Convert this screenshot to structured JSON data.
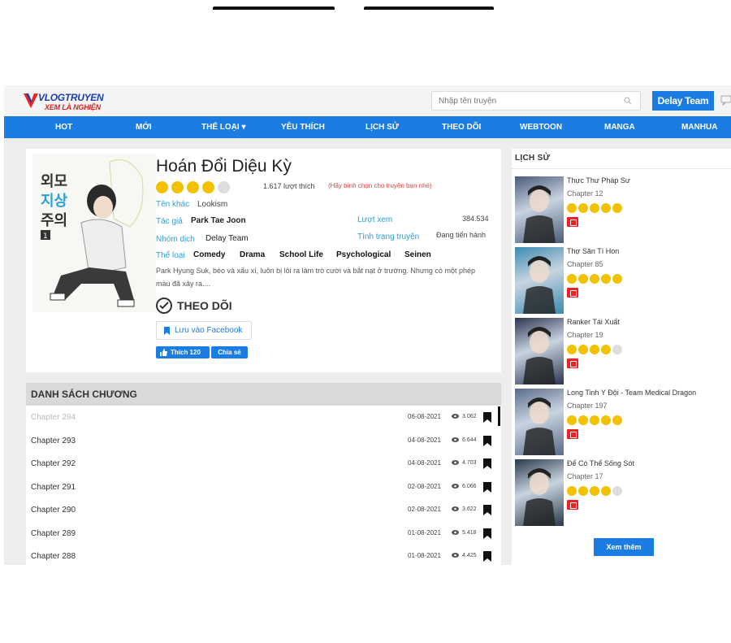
{
  "header": {
    "logo_line1": "VLOGTRUYEN",
    "logo_line2": "XEM LÀ NGHIỆN",
    "search_placeholder": "Nhập tên truyện",
    "team_button": "Delay Team"
  },
  "nav": [
    "HOT",
    "MỚI",
    "THỂ LOẠI ▾",
    "YÊU THÍCH",
    "LỊCH SỬ",
    "THEO DÕI",
    "WEBTOON",
    "MANGA",
    "MANHUA"
  ],
  "manga": {
    "title": "Hoán Đổi Diệu Kỳ",
    "rating": 4,
    "likes": "1.617 lượt thích",
    "vote_prompt": "(Hãy bình chọn cho truyện bạn nhé)",
    "other_name_label": "Tên khác",
    "other_name": "Lookism",
    "author_label": "Tác giả",
    "author": "Park Tae Joon",
    "views_label": "Lượt xem",
    "views": "384.534",
    "translator_label": "Nhóm dịch",
    "translator": "Delay Team",
    "status_label": "Tình trạng truyện",
    "status": "Đang tiến hành",
    "genre_label": "Thể loại",
    "genres": [
      "Comedy",
      "Drama",
      "School Life",
      "Psychological",
      "Seinen"
    ],
    "description": "Park Hyung Suk, béo và xấu xí, luôn bị lôi ra làm trò cười và bắt nạt ở trường. Nhưng có một phép màu đã xảy ra....",
    "follow_label": "THEO DÕI",
    "save_fb_label": "Lưu vào Facebook",
    "fb_like_label": "Thích 120",
    "fb_share_label": "Chia sẻ",
    "cover_text": [
      "외모",
      "지상",
      "주의"
    ],
    "cover_volume": "1"
  },
  "chapters": {
    "heading": "DANH SÁCH CHƯƠNG",
    "rows": [
      {
        "name": "Chapter 294",
        "date": "06-08-2021",
        "views": "3.062",
        "faded": true
      },
      {
        "name": "Chapter 293",
        "date": "04-08-2021",
        "views": "6.644"
      },
      {
        "name": "Chapter 292",
        "date": "04-08-2021",
        "views": "4.703"
      },
      {
        "name": "Chapter 291",
        "date": "02-08-2021",
        "views": "6.066"
      },
      {
        "name": "Chapter 290",
        "date": "02-08-2021",
        "views": "3.622"
      },
      {
        "name": "Chapter 289",
        "date": "01-08-2021",
        "views": "5.418"
      },
      {
        "name": "Chapter 288",
        "date": "01-08-2021",
        "views": "4.425"
      }
    ]
  },
  "history": {
    "heading": "LỊCH SỬ",
    "items": [
      {
        "name": "Thực Thư Pháp Sư",
        "chapter": "Chapter 12",
        "rating": 5,
        "thumb_color": "#4a5a7a"
      },
      {
        "name": "Thợ Săn Tí Hon",
        "chapter": "Chapter 85",
        "rating": 5,
        "thumb_color": "#3a8ab0"
      },
      {
        "name": "Ranker Tái Xuất",
        "chapter": "Chapter 19",
        "rating": 4,
        "thumb_color": "#2a3550"
      },
      {
        "name": "Long Tinh Y Đội - Team Medical Dragon",
        "chapter": "Chapter 197",
        "rating": 5,
        "thumb_color": "#5a6a8a"
      },
      {
        "name": "Để Có Thể Sống Sót",
        "chapter": "Chapter 17",
        "rating": 4,
        "thumb_color": "#2a3a4a"
      }
    ],
    "more_label": "Xem thêm"
  },
  "colors": {
    "accent": "#1b7ce2",
    "star": "#f2c200",
    "label": "#2aa0d8",
    "danger": "#e22222"
  }
}
